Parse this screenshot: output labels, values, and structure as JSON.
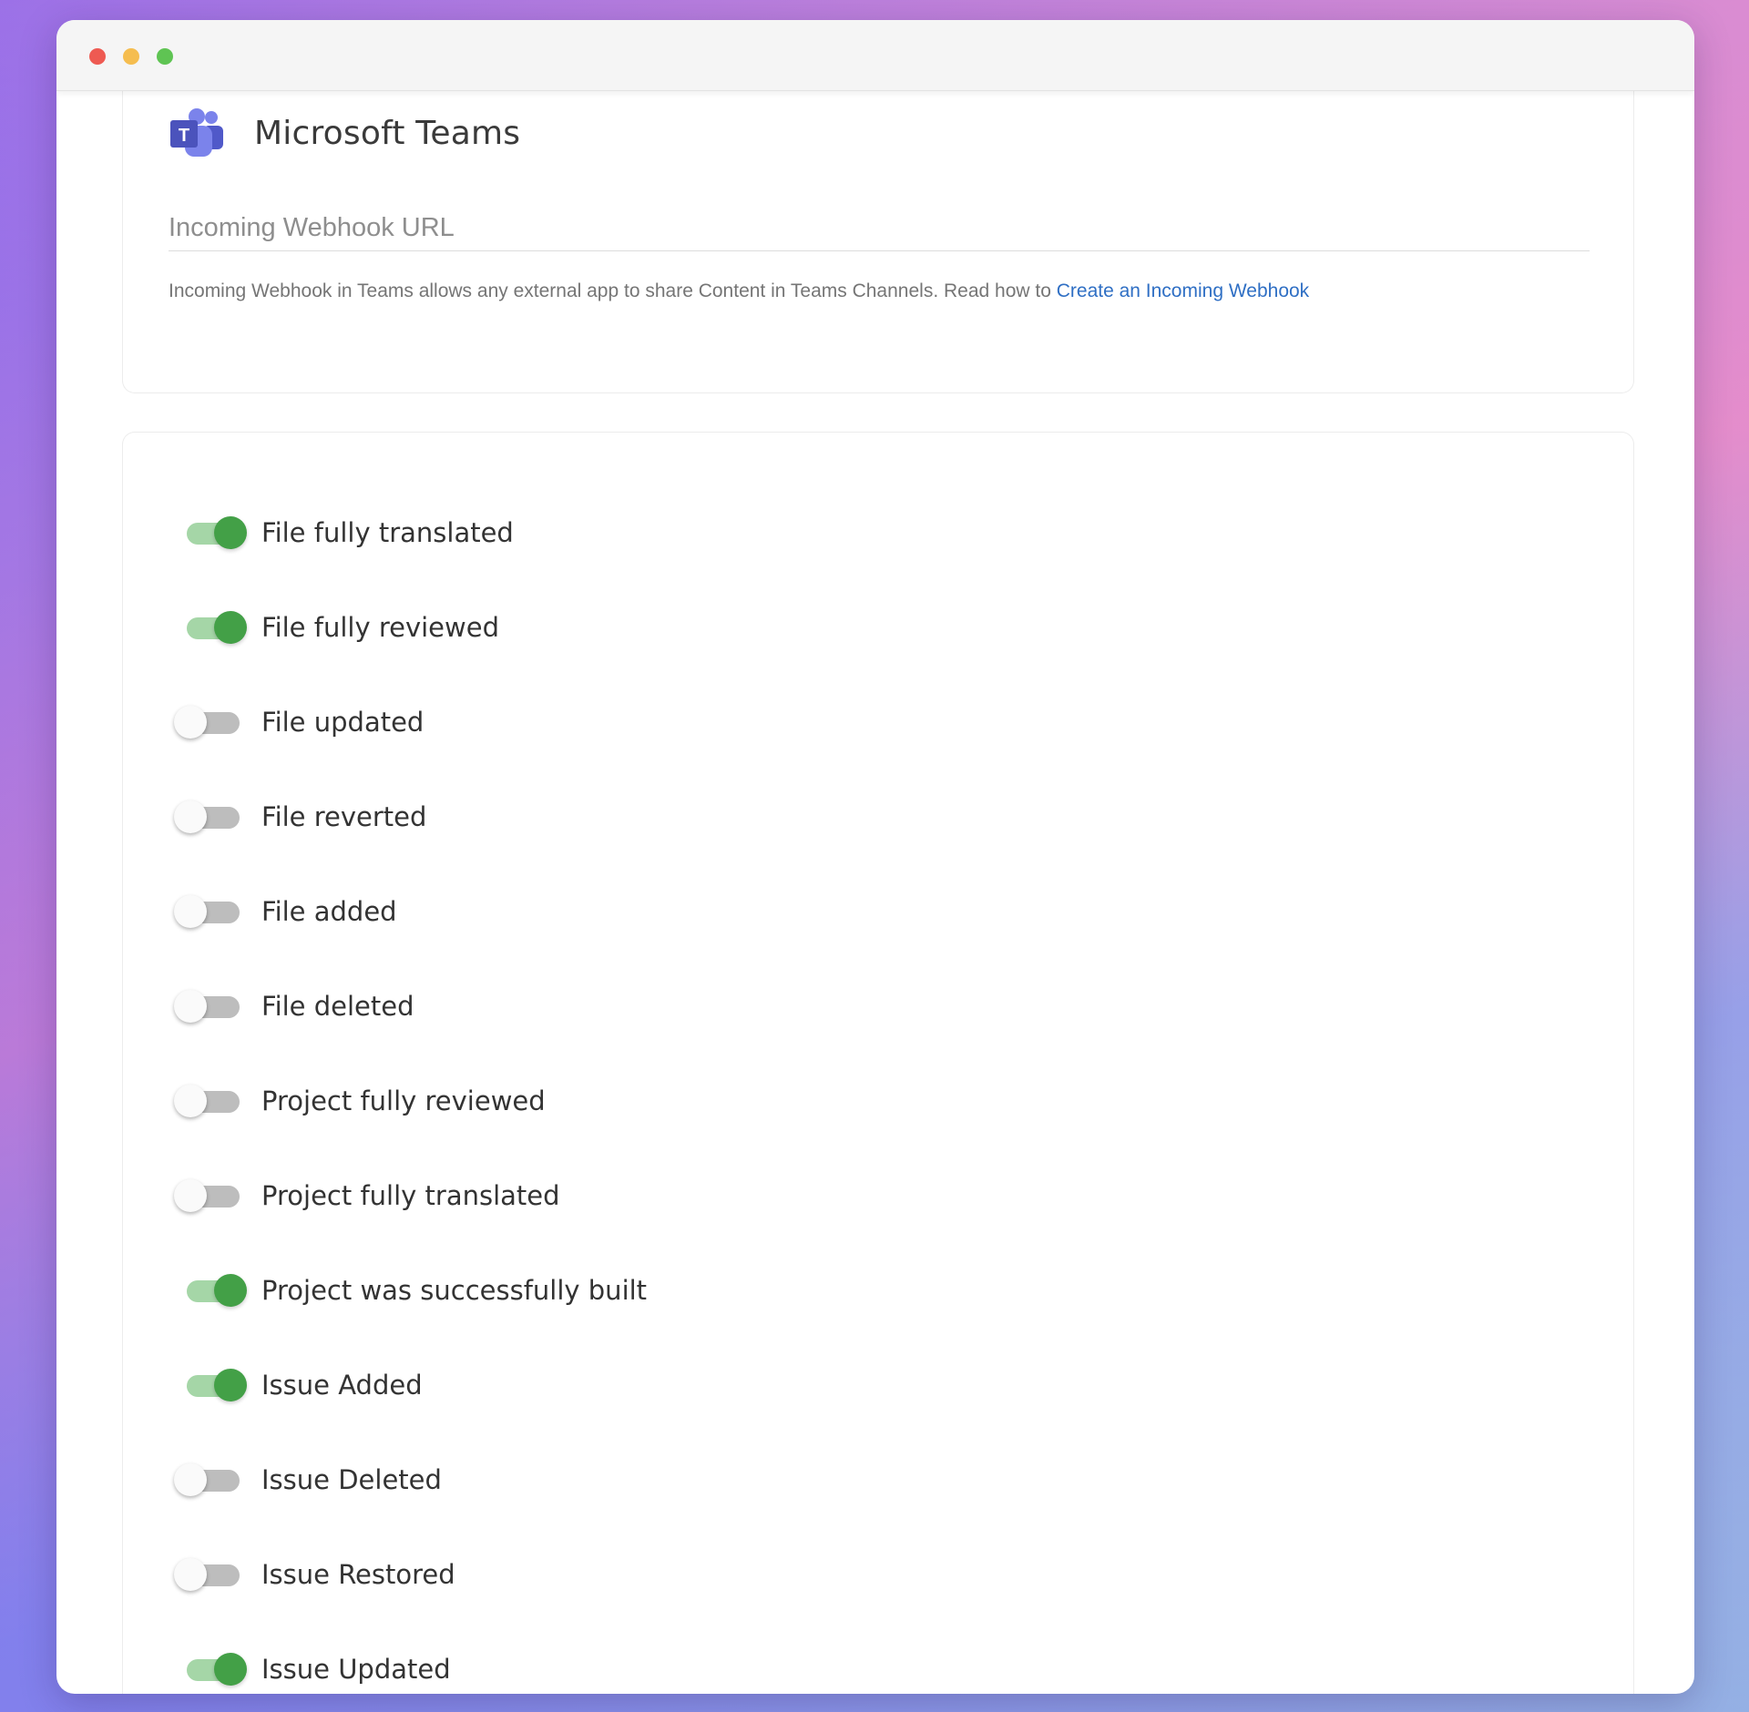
{
  "integration": {
    "title": "Microsoft Teams",
    "logo_icon": "microsoft-teams-icon"
  },
  "webhook": {
    "placeholder": "Incoming Webhook URL",
    "value": "",
    "help_text": "Incoming Webhook in Teams allows any external app to share Content in Teams Channels. Read how to ",
    "help_link": "Create an Incoming Webhook"
  },
  "colors": {
    "toggle_on": "#43a047",
    "toggle_on_track": "#a5d6a7",
    "toggle_off_track": "#bdbdbd",
    "link": "#2f6fc4"
  },
  "events": [
    {
      "label": "File fully translated",
      "enabled": true
    },
    {
      "label": "File fully reviewed",
      "enabled": true
    },
    {
      "label": "File updated",
      "enabled": false
    },
    {
      "label": "File reverted",
      "enabled": false
    },
    {
      "label": "File added",
      "enabled": false
    },
    {
      "label": "File deleted",
      "enabled": false
    },
    {
      "label": "Project fully reviewed",
      "enabled": false
    },
    {
      "label": "Project fully translated",
      "enabled": false
    },
    {
      "label": "Project was successfully built",
      "enabled": true
    },
    {
      "label": "Issue Added",
      "enabled": true
    },
    {
      "label": "Issue Deleted",
      "enabled": false
    },
    {
      "label": "Issue Restored",
      "enabled": false
    },
    {
      "label": "Issue Updated",
      "enabled": true
    }
  ]
}
